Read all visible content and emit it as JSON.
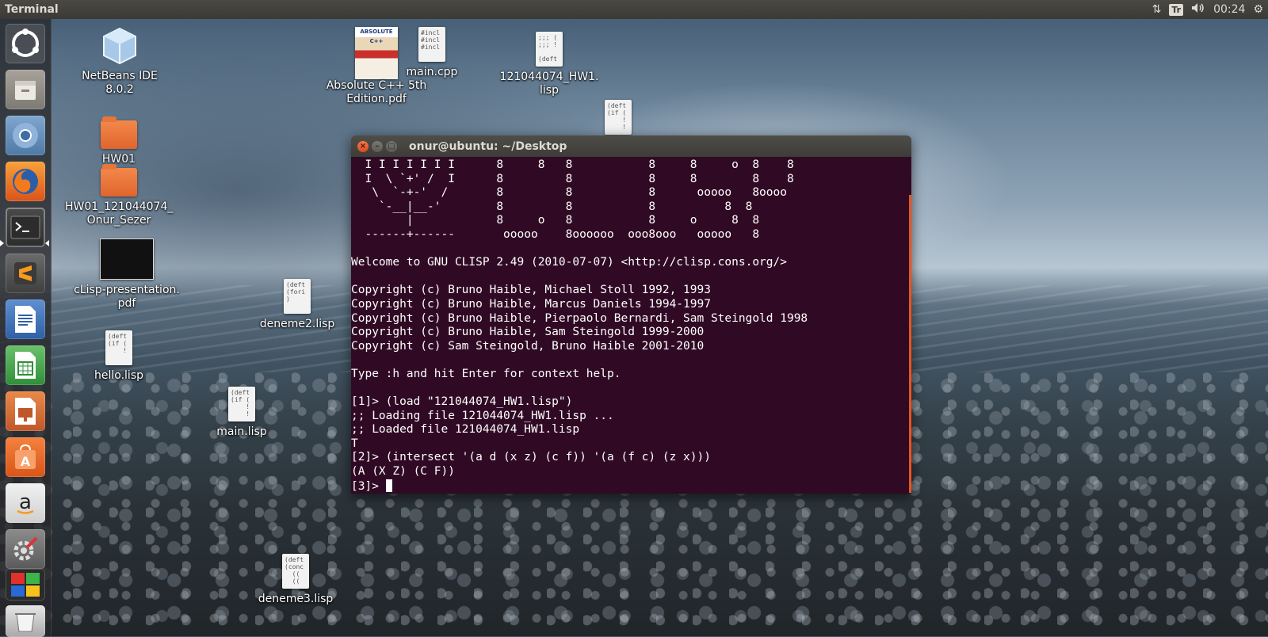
{
  "top_panel": {
    "app_title": "Terminal",
    "keyboard_layout": "Tr",
    "time": "00:24",
    "icons": [
      "network-icon",
      "keyboard-icon",
      "volume-icon",
      "gear-icon"
    ]
  },
  "launcher": {
    "items": [
      {
        "name": "dash-icon"
      },
      {
        "name": "files-icon"
      },
      {
        "name": "chromium-icon"
      },
      {
        "name": "firefox-icon"
      },
      {
        "name": "terminal-icon"
      },
      {
        "name": "sublime-text-icon"
      },
      {
        "name": "libreoffice-writer-icon"
      },
      {
        "name": "libreoffice-calc-icon"
      },
      {
        "name": "libreoffice-impress-icon"
      },
      {
        "name": "software-center-icon"
      },
      {
        "name": "amazon-icon"
      },
      {
        "name": "system-settings-icon"
      },
      {
        "name": "workspace-switcher-icon"
      },
      {
        "name": "trash-icon"
      }
    ]
  },
  "desktop": {
    "icons": {
      "netbeans": {
        "label": "NetBeans IDE 8.0.2"
      },
      "hw01": {
        "label": "HW01"
      },
      "hw01_named": {
        "label_1": "HW01_121044074_",
        "label_2": "Onur_Sezer"
      },
      "clisp_pdf": {
        "label_1": "cLisp-presentation.",
        "label_2": "pdf"
      },
      "hello": {
        "label": "hello.lisp",
        "thumb": "(deft\n(if (\n    !"
      },
      "main_lisp": {
        "label": "main.lisp",
        "thumb": "(deft\n(if (\n    !\n    !"
      },
      "deneme2": {
        "label": "deneme2.lisp",
        "thumb": "(deft\n(fori\n)"
      },
      "deneme3": {
        "label": "deneme3.lisp",
        "thumb": "(deft\n(conc\n  ((\n  (("
      },
      "absolute_pdf": {
        "label_1": "Absolute C++ 5th",
        "label_2": "Edition.pdf",
        "cover_text": "ABSOLUTE C++"
      },
      "main_cpp": {
        "label": "main.cpp",
        "thumb": "#incl\n#incl\n#incl"
      },
      "hw1_lisp": {
        "label_1": "121044074_HW1.",
        "label_2": "lisp",
        "thumb": ";;; (\n;;; !\n\n(deft"
      },
      "unnamed_lisp": {
        "thumb": "(deft\n(if (\n    !\n    !"
      }
    }
  },
  "terminal": {
    "title": "onur@ubuntu: ~/Desktop",
    "lines": [
      "  I I I I I I I      8     8   8           8     8     o  8    8",
      "  I  \\ `+' /  I      8         8           8     8        8    8",
      "   \\  `-+-'  /       8         8           8      ooooo   8oooo",
      "    `-__|__-'        8         8           8          8  8",
      "        |            8     o   8           8     o     8  8",
      "  ------+------       ooooo    8oooooo  ooo8ooo   ooooo   8",
      "",
      "Welcome to GNU CLISP 2.49 (2010-07-07) <http://clisp.cons.org/>",
      "",
      "Copyright (c) Bruno Haible, Michael Stoll 1992, 1993",
      "Copyright (c) Bruno Haible, Marcus Daniels 1994-1997",
      "Copyright (c) Bruno Haible, Pierpaolo Bernardi, Sam Steingold 1998",
      "Copyright (c) Bruno Haible, Sam Steingold 1999-2000",
      "Copyright (c) Sam Steingold, Bruno Haible 2001-2010",
      "",
      "Type :h and hit Enter for context help.",
      "",
      "[1]> (load \"121044074_HW1.lisp\")",
      ";; Loading file 121044074_HW1.lisp ...",
      ";; Loaded file 121044074_HW1.lisp",
      "T",
      "[2]> (intersect '(a d (x z) (c f)) '(a (f c) (z x)))",
      "(A (X Z) (C F))"
    ],
    "prompt": "[3]> "
  },
  "colors": {
    "terminal_bg": "#300a24",
    "accent": "#e95420",
    "panel": "#3b3a36"
  }
}
